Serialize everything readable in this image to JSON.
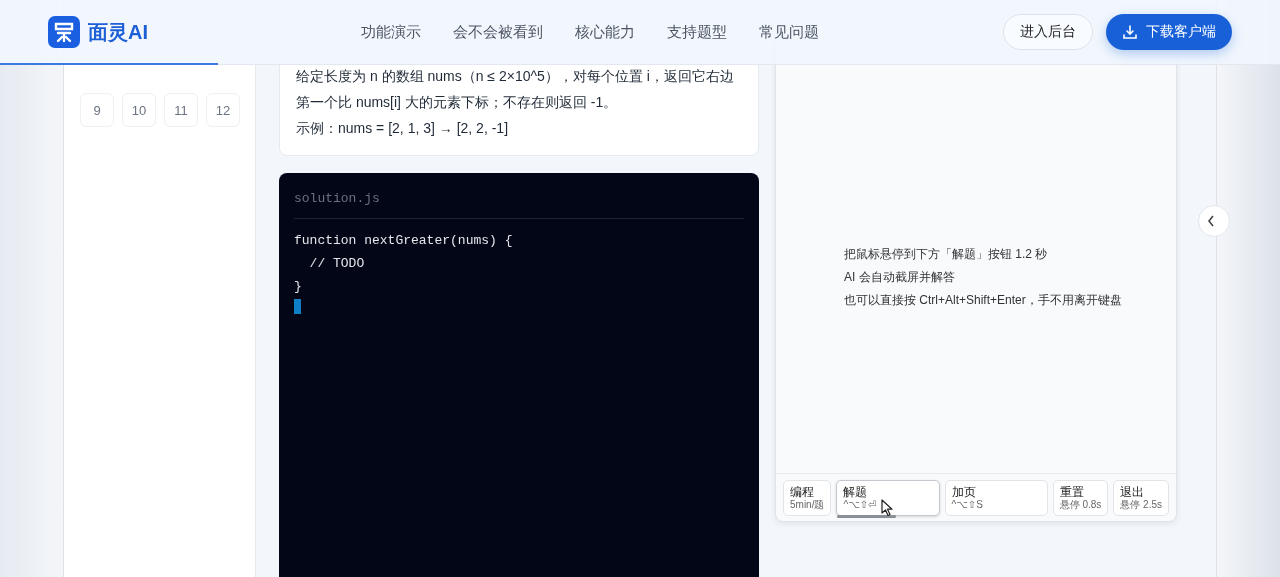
{
  "header": {
    "brand": "面灵AI",
    "nav": [
      "功能演示",
      "会不会被看到",
      "核心能力",
      "支持题型",
      "常见问题"
    ],
    "console_button": "进入后台",
    "download_button": "下载客户端",
    "scroll_progress": {
      "level": 0.17
    }
  },
  "question_numbers": [
    "9",
    "10",
    "11",
    "12"
  ],
  "problem": {
    "lines": [
      "给定长度为 n 的数组 nums（n ≤ 2×10^5），对每个位置 i，返回它右边第一个比 nums[i] 大的元素下标；不存在则返回 -1。",
      "示例：nums = [2, 1, 3] → [2, 2, -1]"
    ]
  },
  "editor": {
    "filename": "solution.js",
    "code": [
      "function nextGreater(nums) {",
      "  // TODO",
      "}"
    ]
  },
  "assistant": {
    "hints": [
      "把鼠标悬停到下方「解题」按钮 1.2 秒",
      "AI 会自动截屏并解答",
      "也可以直接按 Ctrl+Alt+Shift+Enter，手不用离开键盘"
    ],
    "actions": [
      {
        "label": "编程",
        "sub": "5min/题",
        "kind": "compact"
      },
      {
        "label": "解题",
        "sub": "^⌥⇧⏎",
        "kind": "shortcut",
        "level": 0.58
      },
      {
        "label": "加页",
        "sub": "^⌥⇧S",
        "kind": "shortcut"
      },
      {
        "label": "重置",
        "sub": "悬停 0.8s",
        "kind": "compact"
      },
      {
        "label": "退出",
        "sub": "悬停 2.5s",
        "kind": "compact"
      }
    ]
  }
}
